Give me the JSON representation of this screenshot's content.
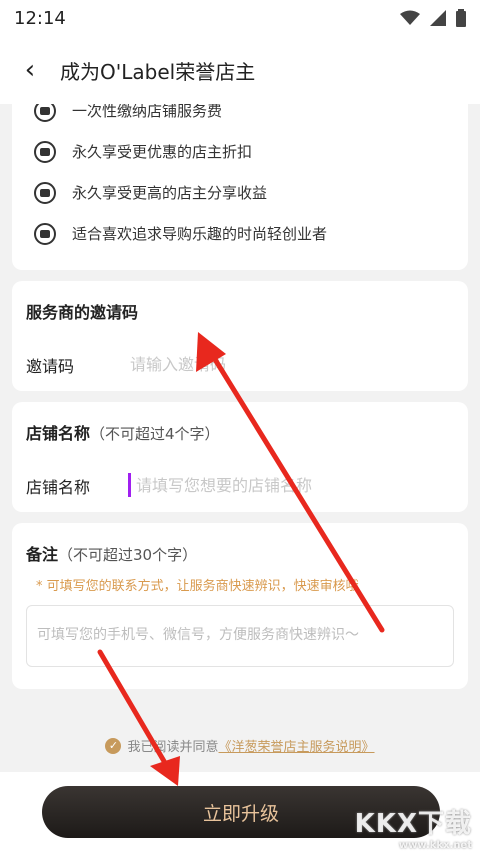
{
  "status_bar": {
    "time": "12:14"
  },
  "nav": {
    "back_icon": "‹",
    "title": "成为O'Label荣誉店主"
  },
  "benefits": [
    {
      "icon": "fee-icon",
      "text": "一次性缴纳店铺服务费"
    },
    {
      "icon": "discount-icon",
      "text": "永久享受更优惠的店主折扣"
    },
    {
      "icon": "moneybag-icon",
      "text": "永久享受更高的店主分享收益"
    },
    {
      "icon": "cart-icon",
      "text": "适合喜欢追求导购乐趣的时尚轻创业者"
    }
  ],
  "invite": {
    "title": "服务商的邀请码",
    "label": "邀请码",
    "placeholder": "请输入邀请码"
  },
  "shop_name": {
    "title": "店铺名称",
    "hint": "（不可超过4个字）",
    "label": "店铺名称",
    "placeholder": "请填写您想要的店铺名称"
  },
  "note": {
    "title": "备注",
    "hint": "（不可超过30个字）",
    "tip": "* 可填写您的联系方式，让服务商快速辨识，快速审核哦",
    "placeholder": "可填写您的手机号、微信号，方便服务商快速辨识～"
  },
  "agreement": {
    "check_icon": "✓",
    "prefix": "我已阅读并同意",
    "link": "《洋葱荣誉店主服务说明》"
  },
  "cta": {
    "label": "立即升级"
  },
  "watermark": {
    "big": "KKX下载",
    "small": "www.kkx.net"
  },
  "colors": {
    "accent_gold": "#c79a5c",
    "tip_orange": "#d99a4e",
    "button_dark": "#2a2624",
    "arrow_red": "#e8281e"
  }
}
